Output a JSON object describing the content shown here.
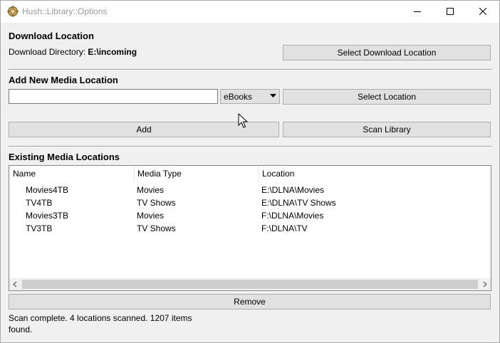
{
  "window": {
    "title": "Hush::Library::Options"
  },
  "download": {
    "section_title": "Download Location",
    "dir_label": "Download Directory:",
    "dir_value": "E:\\incoming",
    "select_button": "Select Download Location"
  },
  "add_media": {
    "section_title": "Add New Media Location",
    "path_value": "",
    "type_selected": "eBooks",
    "select_button": "Select Location",
    "add_button": "Add",
    "scan_button": "Scan Library"
  },
  "existing": {
    "section_title": "Existing Media Locations",
    "columns": [
      "Name",
      "Media Type",
      "Location"
    ],
    "rows": [
      {
        "name": "Movies4TB",
        "type": "Movies",
        "location": "E:\\DLNA\\Movies"
      },
      {
        "name": "TV4TB",
        "type": "TV Shows",
        "location": "E:\\DLNA\\TV Shows"
      },
      {
        "name": "Movies3TB",
        "type": "Movies",
        "location": "F:\\DLNA\\Movies"
      },
      {
        "name": "TV3TB",
        "type": "TV Shows",
        "location": "F:\\DLNA\\TV"
      }
    ],
    "remove_button": "Remove"
  },
  "status": {
    "line1": "Scan complete. 4 locations scanned. 1207 items",
    "line2": "found."
  },
  "icons": {
    "app": "app-icon",
    "minimize": "minimize-icon",
    "maximize": "maximize-icon",
    "close": "close-icon",
    "dropdown": "chevron-down-icon",
    "scroll_left": "chevron-left-icon",
    "scroll_right": "chevron-right-icon"
  }
}
